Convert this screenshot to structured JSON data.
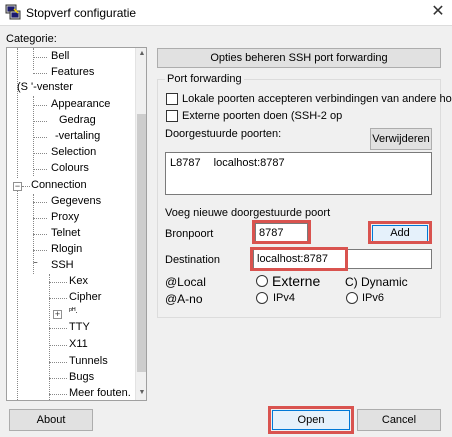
{
  "window": {
    "title": "Stopverf configuratie",
    "close_glyph": "✕"
  },
  "category_label": "Categorie:",
  "tree": {
    "items": {
      "bell": "Bell",
      "features": "Features",
      "window": "(S '-venster",
      "appearance": "Appearance",
      "behaviour": "Gedrag",
      "translation": "-vertaling",
      "selection": "Selection",
      "colours": "Colours",
      "connection": "Connection",
      "data": "Gegevens",
      "proxy": "Proxy",
      "telnet": "Telnet",
      "rlogin": "Rlogin",
      "ssh": "SSH",
      "kex": "Kex",
      "cipher": "Cipher",
      "auth": "ᵖᴴ.",
      "tty": "TTY",
      "x11": "X11",
      "tunnels": "Tunnels",
      "bugs": "Bugs",
      "more_bugs": "Meer fouten."
    },
    "expander_minus": "−",
    "expander_plus": "+"
  },
  "panel": {
    "header_button": "Opties beheren SSH port forwarding",
    "group_title": "Port forwarding",
    "chk_local_accept": "Lokale poorten accepteren verbindingen van andere hosts",
    "chk_remote_ports": "Externe poorten doen (SSH-2 op",
    "forwarded_ports_label": "Doorgestuurde poorten:",
    "remove_button": "Verwijderen",
    "forwarded_list": [
      {
        "port": "L8787",
        "dest": "localhost:8787"
      }
    ],
    "add_new_label": "Voeg nieuwe doorgestuurde poort",
    "source_port_label": "Bronpoort",
    "source_port_value": "8787",
    "add_button": "Add",
    "destination_label": "Destination",
    "destination_value": "localhost:8787",
    "radio_local": "@Local",
    "radio_remote": "Externe",
    "radio_dynamic": "C) Dynamic",
    "radio_auto": "@A-no",
    "radio_ipv4": "IPv4",
    "radio_ipv6": "IPv6"
  },
  "footer": {
    "about": "About",
    "open": "Open",
    "cancel": "Cancel"
  },
  "colors": {
    "highlight": "#d9534f"
  }
}
